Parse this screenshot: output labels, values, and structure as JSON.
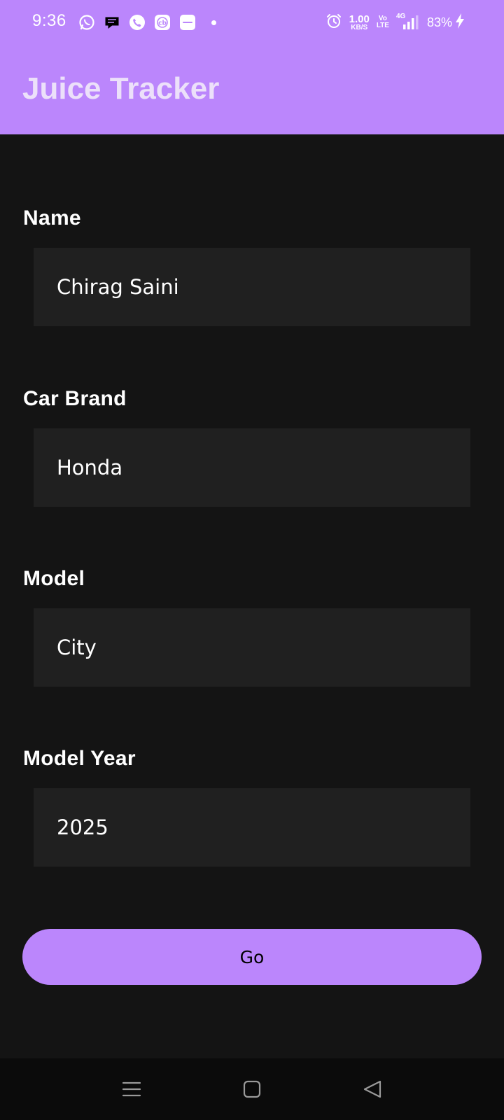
{
  "status_bar": {
    "time": "9:36",
    "notification_icons": [
      "whatsapp-icon",
      "chat-bubble-icon",
      "phone-icon",
      "cb-app-icon",
      "zomato-icon"
    ],
    "network_speed_value": "1.00",
    "network_speed_unit": "KB/S",
    "volte_top": "Vo",
    "volte_bottom": "LTE",
    "network_type": "4G",
    "battery_percent": "83%"
  },
  "app_bar": {
    "title": "Juice Tracker",
    "color": "#bb86fc"
  },
  "form": {
    "fields": [
      {
        "label": "Name",
        "value": "Chirag Saini"
      },
      {
        "label": "Car Brand",
        "value": "Honda"
      },
      {
        "label": "Model",
        "value": "City"
      },
      {
        "label": "Model Year",
        "value": "2025"
      }
    ],
    "submit_label": "Go"
  },
  "nav_bar": {
    "buttons": [
      "menu-icon",
      "home-icon",
      "back-icon"
    ]
  }
}
